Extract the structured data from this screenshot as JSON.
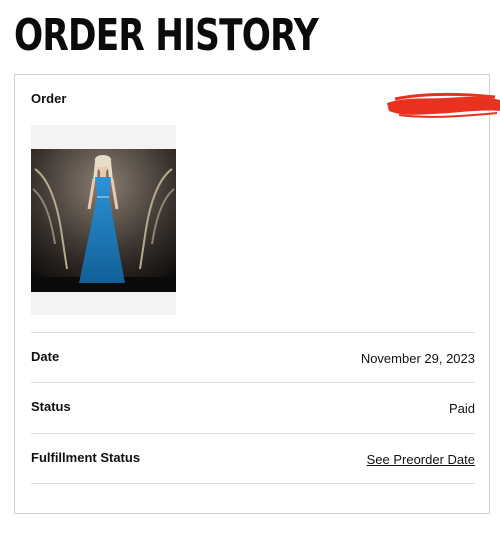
{
  "page": {
    "title": "ORDER HISTORY"
  },
  "order": {
    "label": "Order",
    "product_image": "product-photo-doll-blue-gown"
  },
  "details": [
    {
      "label": "Date",
      "value": "November 29, 2023",
      "is_link": false
    },
    {
      "label": "Status",
      "value": "Paid",
      "is_link": false
    },
    {
      "label": "Fulfillment Status",
      "value": "See Preorder Date",
      "is_link": true
    }
  ],
  "colors": {
    "redaction": "#e8321f",
    "gown": "#1f7fc4",
    "border": "#cfcfcf"
  }
}
